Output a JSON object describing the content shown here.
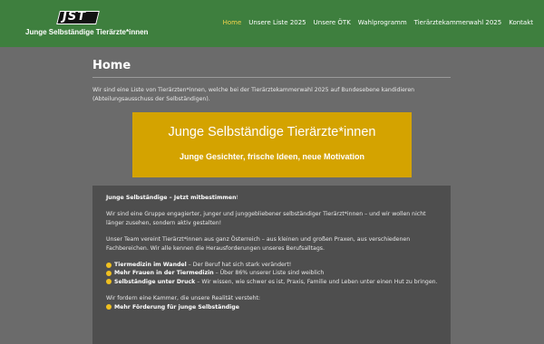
{
  "header": {
    "logo_text": "JST",
    "site_name": "Junge Selbständige Tierärzte*innen",
    "nav": [
      {
        "label": "Home",
        "active": true
      },
      {
        "label": "Unsere Liste 2025"
      },
      {
        "label": "Unsere ÖTK"
      },
      {
        "label": "Wahlprogramm"
      },
      {
        "label": "Tierärztekammerwahl 2025"
      },
      {
        "label": "Kontakt"
      }
    ],
    "colors": {
      "bar": "#3e7f3e",
      "active_link": "#f2d24b"
    }
  },
  "main": {
    "title": "Home",
    "intro": "Wir sind eine Liste von Tierärzten*innen, welche bei der Tierärztekammerwahl 2025 auf Bundesebene kandidieren (Abteilungsausschuss der Selbständigen).",
    "banner": {
      "title": "Junge Selbständige Tierärzte*innen",
      "subtitle": "Junge Gesichter, frische Ideen, neue Motivation",
      "color": "#d4a300"
    },
    "card": {
      "heading": "Junge Selbständige – Jetzt mitbestimmen",
      "heading_suffix": "!",
      "p1": "Wir sind eine Gruppe engagierter, junger und junggebliebener selbständiger Tierärzt*innen – und wir wollen nicht länger zusehen, sondern aktiv gestalten!",
      "p2": "Unser Team vereint Tierärzt*innen aus ganz Österreich – aus kleinen und großen Praxen, aus verschiedenen Fachbereichen. Wir alle kennen die Herausforderungen unseres Berufsalltags.",
      "bullets": [
        {
          "bold": "Tiermedizin im Wandel",
          "text": " – Der Beruf hat sich stark verändert!"
        },
        {
          "bold": "Mehr Frauen in der Tiermedizin",
          "text": " – Über 86% unserer Liste sind weiblich"
        },
        {
          "bold": "Selbständige unter Druck",
          "text": " – Wir wissen, wie schwer es ist, Praxis, Familie und Leben unter einen Hut zu bringen."
        }
      ],
      "p3": "Wir fordern eine Kammer, die unsere Realität versteht:",
      "bullet2": {
        "bold": "Mehr Förderung für junge Selbständige",
        "text": ""
      },
      "bullet_icon": "yellow-circle-icon"
    }
  }
}
